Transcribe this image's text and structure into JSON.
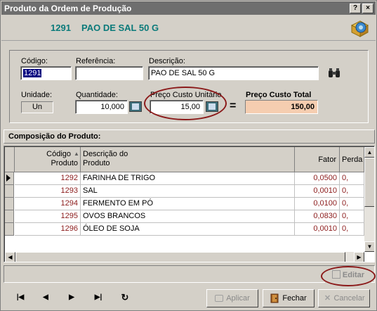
{
  "window": {
    "title": "Produto da Ordem de Produção",
    "help_button": "?",
    "close_button": "×"
  },
  "header": {
    "code": "1291",
    "name": "PAO DE SAL 50 G"
  },
  "form": {
    "codigo_label": "Código:",
    "codigo_value": "1291",
    "referencia_label": "Referência:",
    "referencia_value": "",
    "descricao_label": "Descrição:",
    "descricao_value": "PAO DE SAL 50 G",
    "unidade_label": "Unidade:",
    "unidade_value": "Un",
    "quantidade_label": "Quantidade:",
    "quantidade_value": "10,000",
    "preco_unit_label": "Preço Custo Unitário",
    "preco_unit_value": "15,00",
    "equals": "=",
    "preco_total_label": "Preço Custo Total",
    "preco_total_value": "150,00"
  },
  "composition": {
    "title": "Composição do Produto:",
    "columns": {
      "codigo_line1": "Código",
      "codigo_line2": "Produto",
      "descricao_line1": "Descrição do",
      "descricao_line2": "Produto",
      "fator": "Fator",
      "perda": "Perda"
    },
    "rows": [
      {
        "code": "1292",
        "desc": "FARINHA DE TRIGO",
        "fator": "0,0500",
        "perda": "0,"
      },
      {
        "code": "1293",
        "desc": "SAL",
        "fator": "0,0010",
        "perda": "0,"
      },
      {
        "code": "1294",
        "desc": "FERMENTO EM PÓ",
        "fator": "0,0100",
        "perda": "0,"
      },
      {
        "code": "1295",
        "desc": "OVOS BRANCOS",
        "fator": "0,0830",
        "perda": "0,"
      },
      {
        "code": "1296",
        "desc": "ÓLEO DE SOJA",
        "fator": "0,0010",
        "perda": "0,"
      }
    ]
  },
  "actions": {
    "editar": "Editar",
    "aplicar": "Aplicar",
    "fechar": "Fechar",
    "cancelar": "Cancelar"
  },
  "navigator": {
    "first": "|◀",
    "prev": "◀",
    "next": "▶",
    "last": "▶|",
    "refresh": "↻"
  },
  "colors": {
    "title_bar": "#6e6e6e",
    "header_text": "#0a7a7a",
    "code_text": "#8b1a1a",
    "total_bg": "#f5cdb0",
    "highlight_ellipse": "#8b1a1a"
  }
}
